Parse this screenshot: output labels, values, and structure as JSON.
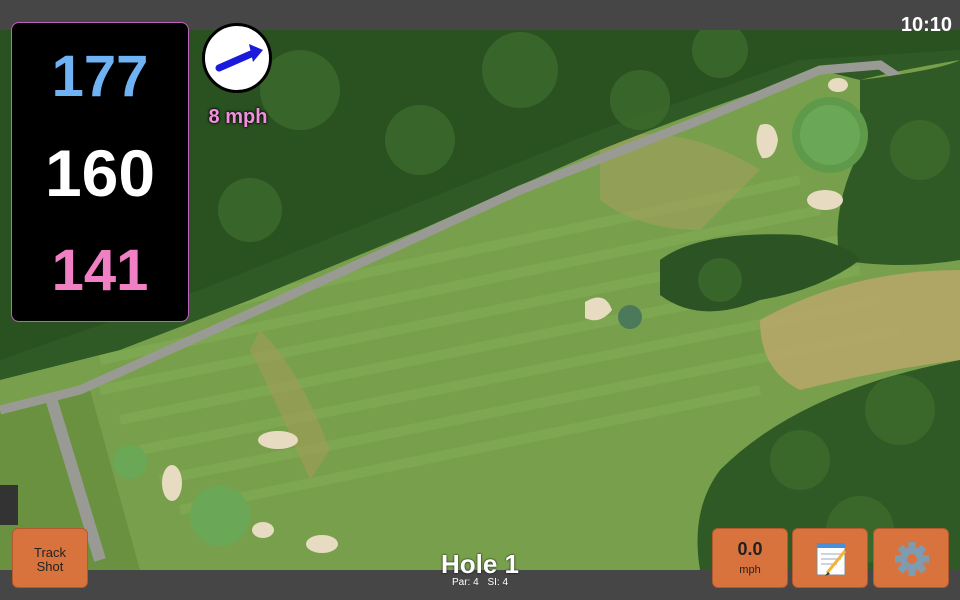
{
  "status": {
    "time": "10:10"
  },
  "distances": {
    "back": "177",
    "middle": "160",
    "front": "141"
  },
  "wind": {
    "speed": "8 mph",
    "icon": "arrow-icon"
  },
  "hole": {
    "title": "Hole 1",
    "par": "Par: 4",
    "si": "SI: 4"
  },
  "buttons": {
    "track_shot": "Track\nShot",
    "speed_value": "0.0",
    "speed_unit": "mph",
    "notes_icon": "notepad-icon",
    "settings_icon": "gear-icon"
  },
  "colors": {
    "back": "#6fb3f5",
    "middle": "#ffffff",
    "front": "#f17fc4",
    "button": "#d9733e",
    "wind_text": "#f28ee0"
  }
}
